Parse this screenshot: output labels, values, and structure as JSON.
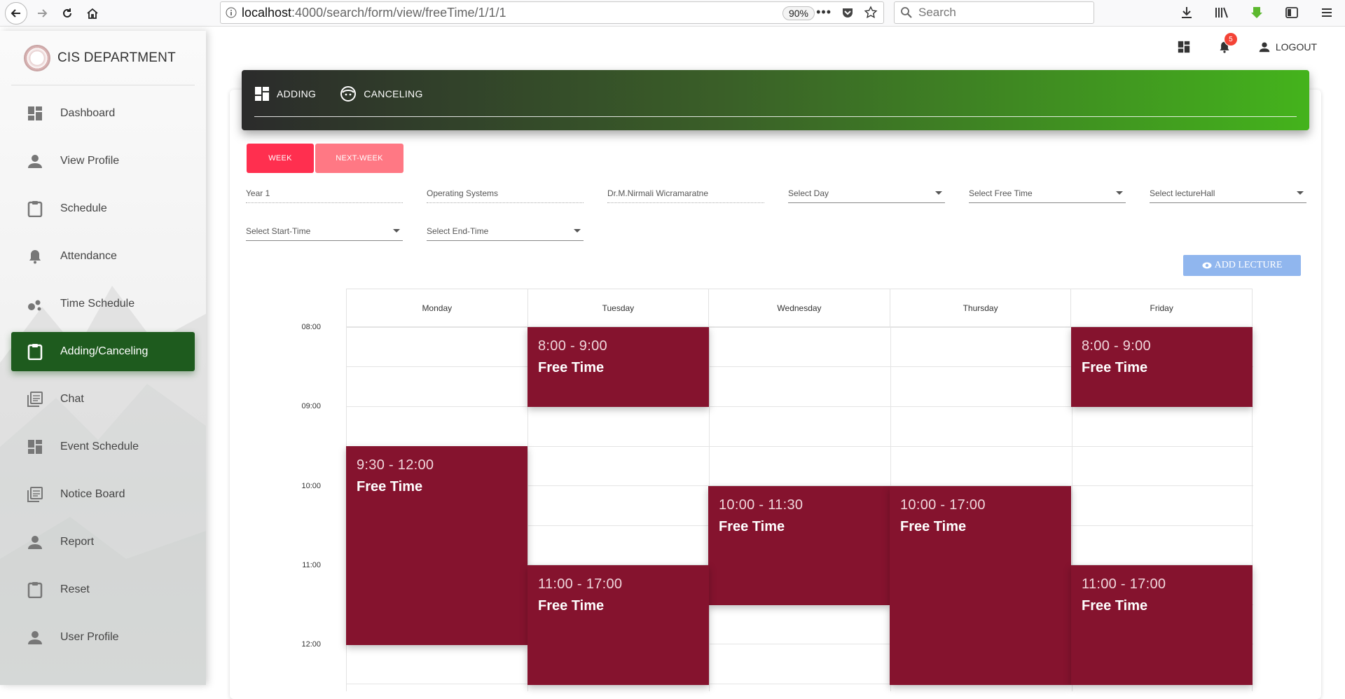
{
  "browser": {
    "url_host": "localhost",
    "url_path": ":4000/search/form/view/freeTime/1/1/1",
    "zoom": "90%",
    "search_placeholder": "Search"
  },
  "sidebar": {
    "brand": "CIS DEPARTMENT",
    "items": [
      {
        "label": "Dashboard",
        "icon": "dashboard-icon",
        "active": false
      },
      {
        "label": "View Profile",
        "icon": "person-icon",
        "active": false
      },
      {
        "label": "Schedule",
        "icon": "clipboard-icon",
        "active": false
      },
      {
        "label": "Attendance",
        "icon": "bell-icon",
        "active": false
      },
      {
        "label": "Time Schedule",
        "icon": "bubbles-icon",
        "active": false
      },
      {
        "label": "Adding/Canceling",
        "icon": "clipboard-icon",
        "active": true
      },
      {
        "label": "Chat",
        "icon": "library-books-icon",
        "active": false
      },
      {
        "label": "Event Schedule",
        "icon": "dashboard-icon",
        "active": false
      },
      {
        "label": "Notice Board",
        "icon": "library-books-icon",
        "active": false
      },
      {
        "label": "Report",
        "icon": "person-icon",
        "active": false
      },
      {
        "label": "Reset",
        "icon": "clipboard-icon",
        "active": false
      },
      {
        "label": "User Profile",
        "icon": "person-icon",
        "active": false
      }
    ]
  },
  "topbar": {
    "notification_count": "5",
    "logout": "LOGOUT"
  },
  "header_tabs": {
    "adding": "ADDING",
    "canceling": "CANCELING"
  },
  "buttons": {
    "week": "WEEK",
    "next_week": "NEXT-WEEK",
    "add_lecture": "ADD LECTURE"
  },
  "form": {
    "year": "Year 1",
    "subject": "Operating Systems",
    "lecturer": "Dr.M.Nirmali Wicramaratne",
    "select_day": "Select Day",
    "select_free_time": "Select Free Time",
    "select_lecture_hall": "Select lectureHall",
    "select_start_time": "Select Start-Time",
    "select_end_time": "Select End-Time"
  },
  "calendar": {
    "days": [
      "Monday",
      "Tuesday",
      "Wednesday",
      "Thursday",
      "Friday"
    ],
    "times": [
      "08:00",
      "09:00",
      "10:00",
      "11:00",
      "12:00"
    ],
    "events": [
      {
        "day": "Tuesday",
        "time": "8:00 - 9:00",
        "title": "Free Time"
      },
      {
        "day": "Friday",
        "time": "8:00 - 9:00",
        "title": "Free Time"
      },
      {
        "day": "Monday",
        "time": "9:30 - 12:00",
        "title": "Free Time"
      },
      {
        "day": "Wednesday",
        "time": "10:00 - 11:30",
        "title": "Free Time"
      },
      {
        "day": "Thursday",
        "time": "10:00 - 17:00",
        "title": "Free Time"
      },
      {
        "day": "Tuesday",
        "time": "11:00 - 17:00",
        "title": "Free Time"
      },
      {
        "day": "Friday",
        "time": "11:00 - 17:00",
        "title": "Free Time"
      }
    ]
  },
  "colors": {
    "active_menu": "#1e5b1e",
    "event": "#85132e",
    "week_button": "#ff2f4f",
    "next_week_button": "#ff7884",
    "add_lecture_button": "#90b6ee"
  }
}
